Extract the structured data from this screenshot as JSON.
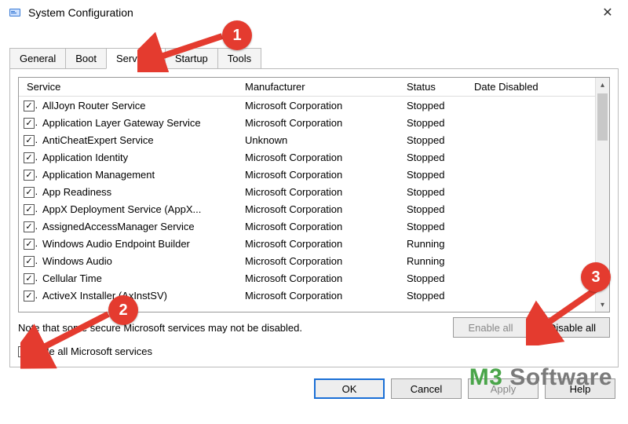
{
  "window": {
    "title": "System Configuration"
  },
  "tabs": [
    {
      "label": "General"
    },
    {
      "label": "Boot"
    },
    {
      "label": "Services"
    },
    {
      "label": "Startup"
    },
    {
      "label": "Tools"
    }
  ],
  "active_tab_index": 2,
  "columns": {
    "service": "Service",
    "manufacturer": "Manufacturer",
    "status": "Status",
    "date_disabled": "Date Disabled"
  },
  "services": [
    {
      "checked": true,
      "name": "AllJoyn Router Service",
      "manufacturer": "Microsoft Corporation",
      "status": "Stopped",
      "date_disabled": ""
    },
    {
      "checked": true,
      "name": "Application Layer Gateway Service",
      "manufacturer": "Microsoft Corporation",
      "status": "Stopped",
      "date_disabled": ""
    },
    {
      "checked": true,
      "name": "AntiCheatExpert Service",
      "manufacturer": "Unknown",
      "status": "Stopped",
      "date_disabled": ""
    },
    {
      "checked": true,
      "name": "Application Identity",
      "manufacturer": "Microsoft Corporation",
      "status": "Stopped",
      "date_disabled": ""
    },
    {
      "checked": true,
      "name": "Application Management",
      "manufacturer": "Microsoft Corporation",
      "status": "Stopped",
      "date_disabled": ""
    },
    {
      "checked": true,
      "name": "App Readiness",
      "manufacturer": "Microsoft Corporation",
      "status": "Stopped",
      "date_disabled": ""
    },
    {
      "checked": true,
      "name": "AppX Deployment Service (AppX...",
      "manufacturer": "Microsoft Corporation",
      "status": "Stopped",
      "date_disabled": ""
    },
    {
      "checked": true,
      "name": "AssignedAccessManager Service",
      "manufacturer": "Microsoft Corporation",
      "status": "Stopped",
      "date_disabled": ""
    },
    {
      "checked": true,
      "name": "Windows Audio Endpoint Builder",
      "manufacturer": "Microsoft Corporation",
      "status": "Running",
      "date_disabled": ""
    },
    {
      "checked": true,
      "name": "Windows Audio",
      "manufacturer": "Microsoft Corporation",
      "status": "Running",
      "date_disabled": ""
    },
    {
      "checked": true,
      "name": "Cellular Time",
      "manufacturer": "Microsoft Corporation",
      "status": "Stopped",
      "date_disabled": ""
    },
    {
      "checked": true,
      "name": "ActiveX Installer (AxInstSV)",
      "manufacturer": "Microsoft Corporation",
      "status": "Stopped",
      "date_disabled": ""
    }
  ],
  "note_text": "Note that some secure Microsoft services may not be disabled.",
  "enable_all_label": "Enable all",
  "disable_all_label": "Disable all",
  "hide_ms_label": "Hide all Microsoft services",
  "hide_ms_checked": false,
  "buttons": {
    "ok": "OK",
    "cancel": "Cancel",
    "apply": "Apply",
    "help": "Help"
  },
  "annotations": {
    "badge1": "1",
    "badge2": "2",
    "badge3": "3"
  },
  "watermark": {
    "m": "M",
    "three": "3",
    "rest": " Software"
  }
}
